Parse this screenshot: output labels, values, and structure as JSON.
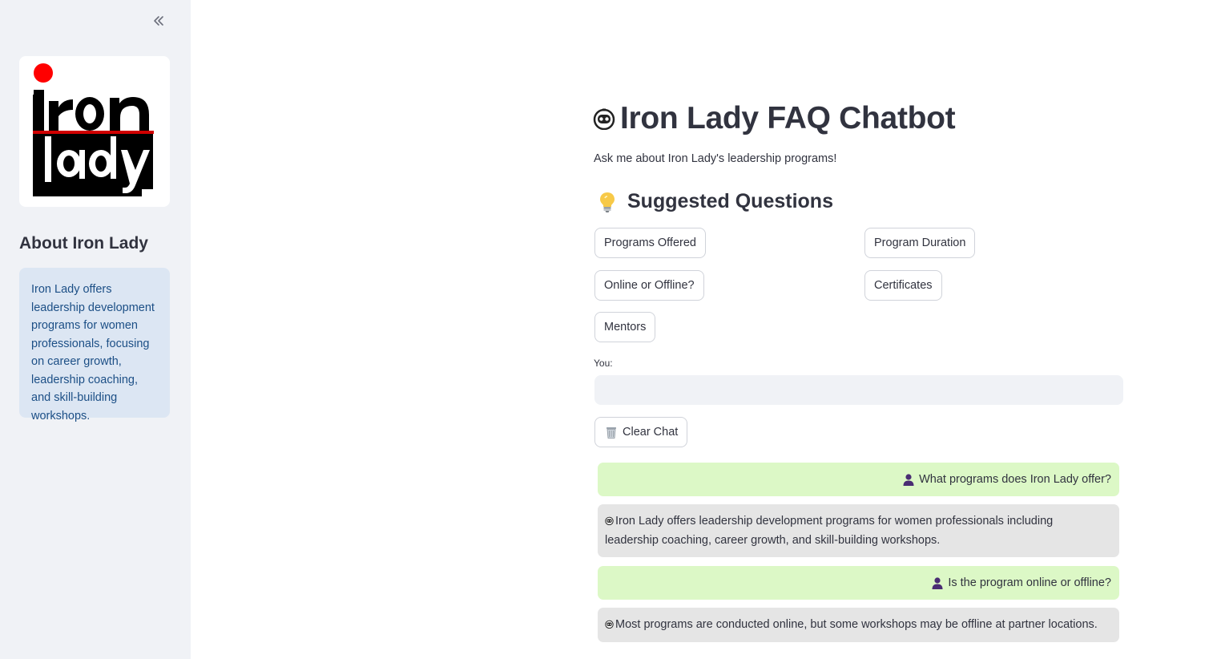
{
  "sidebar": {
    "collapse_icon": "double-chevron-left-icon",
    "logo": {
      "line1": "iron",
      "line2": "Lady",
      "accent": "#ff0000"
    },
    "heading": "About Iron Lady",
    "info": "Iron Lady offers leadership development programs for women professionals, focusing on career growth, leadership coaching, and skill-building workshops."
  },
  "main": {
    "title_icon": "robot-face-icon",
    "title": "Iron Lady FAQ Chatbot",
    "subtitle": "Ask me about Iron Lady's leadership programs!",
    "suggested_icon": "lightbulb-icon",
    "suggested_heading": "Suggested Questions",
    "suggested": [
      "Programs Offered",
      "Program Duration",
      "Online or Offline?",
      "Certificates",
      "Mentors"
    ],
    "input_label": "You:",
    "input_value": "",
    "clear_icon": "wastebasket-icon",
    "clear_label": "Clear Chat",
    "messages": [
      {
        "role": "user",
        "icon": "user-icon",
        "text": "What programs does Iron Lady offer?"
      },
      {
        "role": "bot",
        "icon": "robot-face-icon",
        "text": "Iron Lady offers leadership development programs for women professionals including leadership coaching, career growth, and skill-building workshops."
      },
      {
        "role": "user",
        "icon": "user-icon",
        "text": "Is the program online or offline?"
      },
      {
        "role": "bot",
        "icon": "robot-face-icon",
        "text": "Most programs are conducted online, but some workshops may be offline at partner locations."
      }
    ]
  },
  "colors": {
    "sidebar_bg": "#f0f2f6",
    "info_bg": "#dce6f3",
    "info_text": "#1c4f86",
    "user_bubble": "#dcf8c6",
    "bot_bubble": "#e5e5e5",
    "user_icon": "#4a2d73"
  }
}
